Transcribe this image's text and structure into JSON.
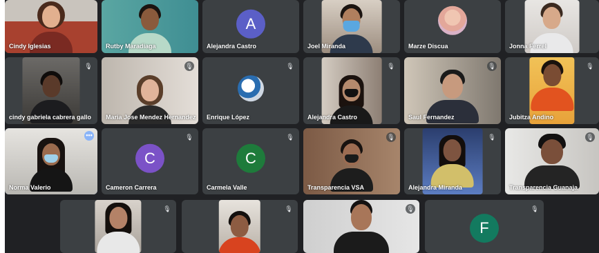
{
  "colors": {
    "background": "#202124",
    "tile": "#3c4043",
    "active_border": "#8ab4f8",
    "avatar_alejandra": "#5b5fc7",
    "avatar_cameron": "#7b52c7",
    "avatar_carmela": "#1e7b3b",
    "avatar_f": "#137a5f"
  },
  "participants": {
    "cindy": {
      "name": "Cindy Iglesias"
    },
    "rutby": {
      "name": "Rutby Maradiaga"
    },
    "alejandra_a": {
      "name": "Alejandra Castro",
      "initial": "A"
    },
    "joel": {
      "name": "Joel Miranda"
    },
    "marze": {
      "name": "Marze Discua"
    },
    "jonna": {
      "name": "Jonna Ferrel"
    },
    "cindy_g": {
      "name": "cindy gabriela cabrera gallo"
    },
    "maria": {
      "name": "Maria Jose Mendez Hernandez"
    },
    "enrique": {
      "name": "Enrique López"
    },
    "alejandra_v": {
      "name": "Alejandra Castro"
    },
    "saul": {
      "name": "Saul Fernandez"
    },
    "jubitza": {
      "name": "Jubitza Andino"
    },
    "norma": {
      "name": "Norma Valerio"
    },
    "cameron": {
      "name": "Cameron Carrera",
      "initial": "C"
    },
    "carmela": {
      "name": "Carmela Valle",
      "initial": "C"
    },
    "transp_vsa": {
      "name": "Transparencia VSA"
    },
    "alejandra_m": {
      "name": "Alejandra Miranda"
    },
    "transp_guanaja": {
      "name": "Transparencia Guanaja"
    },
    "f_user": {
      "initial": "F"
    }
  },
  "icons": {
    "mic_off": "mic-off-icon",
    "more": "more-options-icon"
  },
  "glyphs": {
    "mic_off": "🎙",
    "more": "•••"
  }
}
